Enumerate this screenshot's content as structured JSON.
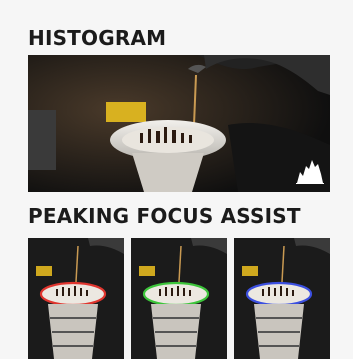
{
  "histogram": {
    "title": "HISTOGRAM",
    "icon": "histogram-icon",
    "image": "coffee-pour-over-photo"
  },
  "peaking": {
    "title": "PEAKING FOCUS ASSIST",
    "thumbnails": [
      {
        "image": "coffee-pour-over-thumb",
        "peaking_color": "#e0352e"
      },
      {
        "image": "coffee-pour-over-thumb",
        "peaking_color": "#3cc43a"
      },
      {
        "image": "coffee-pour-over-thumb",
        "peaking_color": "#3b4fe0"
      }
    ]
  }
}
